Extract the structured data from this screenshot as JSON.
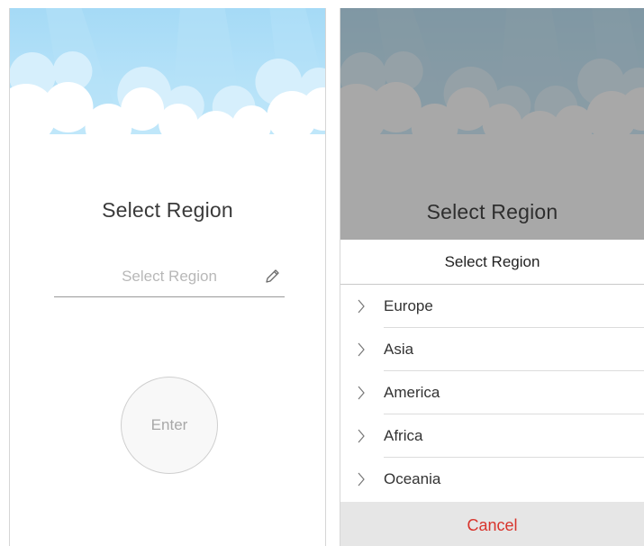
{
  "colors": {
    "sky_top": "#a9dcf6",
    "sky_bottom": "#c9ebfb",
    "cloud": "#ffffff",
    "cloud_shadow": "#dff2fc",
    "cancel_text": "#d8342c",
    "dim_overlay": "#606060"
  },
  "left_screen": {
    "title": "Select Region",
    "region_field": {
      "placeholder": "Select Region",
      "icon": "pencil-icon"
    },
    "enter_button": "Enter"
  },
  "right_screen": {
    "title": "Select Region",
    "sheet": {
      "header": "Select Region",
      "items": [
        {
          "label": "Europe",
          "icon": "chevron-right-icon"
        },
        {
          "label": "Asia",
          "icon": "chevron-right-icon"
        },
        {
          "label": "America",
          "icon": "chevron-right-icon"
        },
        {
          "label": "Africa",
          "icon": "chevron-right-icon"
        },
        {
          "label": "Oceania",
          "icon": "chevron-right-icon"
        }
      ],
      "cancel_label": "Cancel"
    }
  }
}
